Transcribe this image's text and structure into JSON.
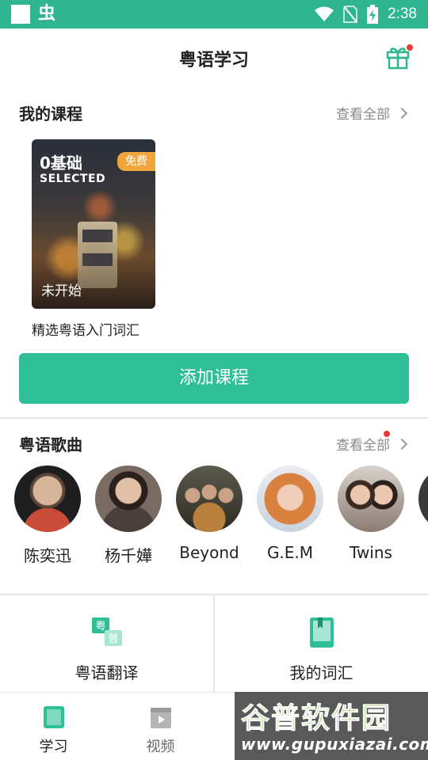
{
  "status_bar": {
    "time": "2:38"
  },
  "header": {
    "title": "粤语学习"
  },
  "my_courses": {
    "title": "我的课程",
    "view_all": "查看全部",
    "course": {
      "badge_top": "0基础",
      "badge_sub": "SELECTED",
      "free_tag": "免费",
      "status": "未开始",
      "name": "精选粤语入门词汇"
    },
    "add_button": "添加课程"
  },
  "songs": {
    "title": "粤语歌曲",
    "view_all": "查看全部",
    "singers": [
      {
        "name": "陈奕迅"
      },
      {
        "name": "杨千嬅"
      },
      {
        "name": "Beyond"
      },
      {
        "name": "G.E.M"
      },
      {
        "name": "Twins"
      }
    ]
  },
  "tools": [
    {
      "label": "粤语翻译",
      "icon": "translate-icon",
      "icon_chars": [
        "粤",
        "普"
      ]
    },
    {
      "label": "我的词汇",
      "icon": "vocab-book-icon"
    }
  ],
  "bottom_nav": [
    {
      "label": "学习",
      "icon": "study-icon"
    },
    {
      "label": "视频",
      "icon": "video-icon"
    }
  ],
  "watermark": {
    "title": "谷普软件园",
    "url": "www.gupuxiazai.com"
  },
  "colors": {
    "accent": "#2fbf97",
    "status_bar": "#2fb590",
    "badge": "#f0a63b",
    "notify_dot": "#e53935"
  }
}
